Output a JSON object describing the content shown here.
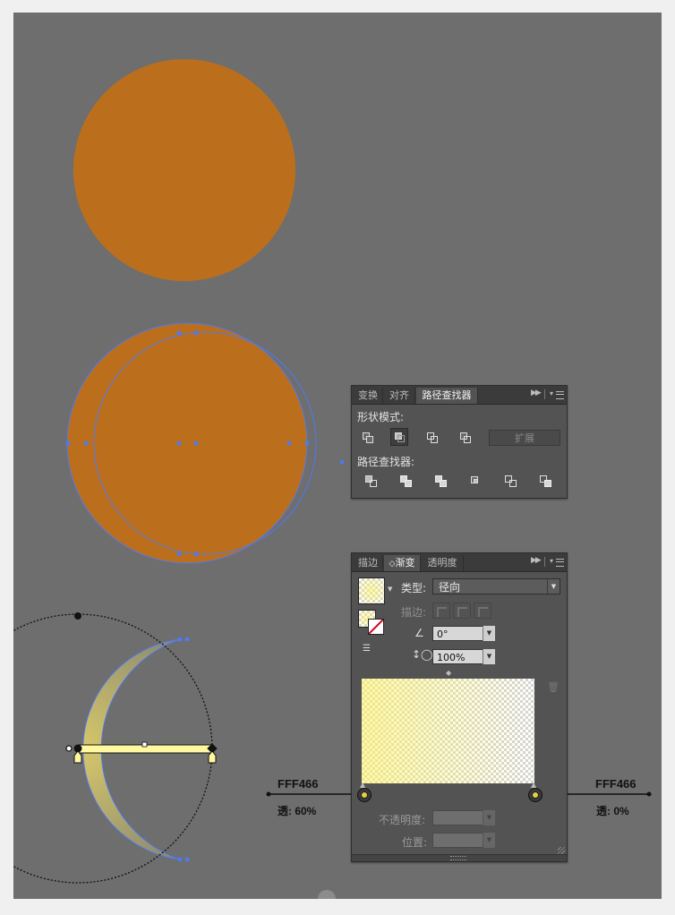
{
  "colors": {
    "canvas": "#6e6e6e",
    "circle_fill": "#bb6f1d",
    "selection_blue": "#4f79f0",
    "gradient_color": "#FFF466"
  },
  "pathfinder_panel": {
    "tabs": [
      "变换",
      "对齐",
      "路径查找器"
    ],
    "active_tab": "路径查找器",
    "shape_modes_label": "形状模式:",
    "shape_mode_icons": [
      "unite-icon",
      "minus-front-icon",
      "intersect-icon",
      "exclude-icon"
    ],
    "expand_label": "扩展",
    "pathfinders_label": "路径查找器:",
    "pathfinder_icons": [
      "divide-icon",
      "trim-icon",
      "merge-icon",
      "crop-icon",
      "outline-icon",
      "minus-back-icon"
    ]
  },
  "gradient_panel": {
    "tabs": [
      "描边",
      "渐变",
      "透明度"
    ],
    "active_tab": "渐变",
    "type_label": "类型:",
    "type_value": "径向",
    "stroke_label": "描边:",
    "angle_value": "0°",
    "aspect_value": "100%",
    "opacity_label": "不透明度:",
    "location_label": "位置:"
  },
  "annotations": {
    "left_color": "FFF466",
    "left_opacity": "透: 60%",
    "right_color": "FFF466",
    "right_opacity": "透: 0%"
  }
}
